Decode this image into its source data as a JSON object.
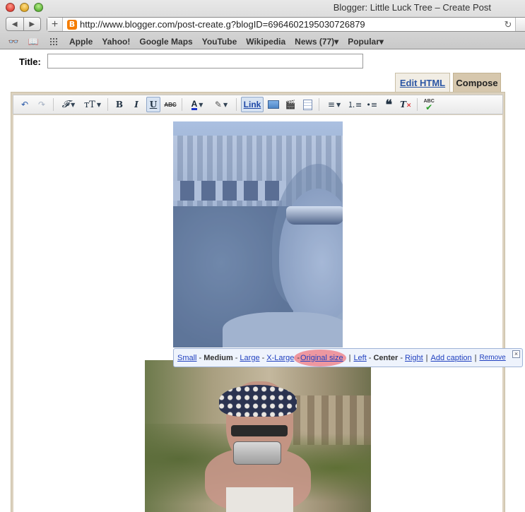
{
  "window": {
    "title": "Blogger: Little Luck Tree – Create Post"
  },
  "browser": {
    "url": "http://www.blogger.com/post-create.g?blogID=6964602195030726879",
    "favicon_letter": "B",
    "bookmarks": [
      "Apple",
      "Yahoo!",
      "Google Maps",
      "YouTube",
      "Wikipedia",
      "News (77)▾",
      "Popular▾"
    ]
  },
  "post": {
    "title_label": "Title:",
    "title_value": ""
  },
  "tabs": {
    "edit_html": "Edit HTML",
    "compose": "Compose"
  },
  "toolbar": {
    "font": "𝓕",
    "font_size": "тT",
    "bold": "B",
    "italic": "I",
    "underline": "U",
    "strike": "ABC",
    "text_color": "A",
    "link": "Link",
    "spellcheck": "ABC"
  },
  "image_bubble": {
    "small": "Small",
    "medium": "Medium",
    "large": "Large",
    "xlarge": "X-Large",
    "original": "Original size",
    "left": "Left",
    "center": "Center",
    "right": "Right",
    "caption": "Add caption",
    "remove": "Remove",
    "close": "×"
  },
  "colors": {
    "accent_link": "#1f3fbf",
    "compose_tab": "#d6c7ad",
    "highlight": "#ec7882"
  }
}
